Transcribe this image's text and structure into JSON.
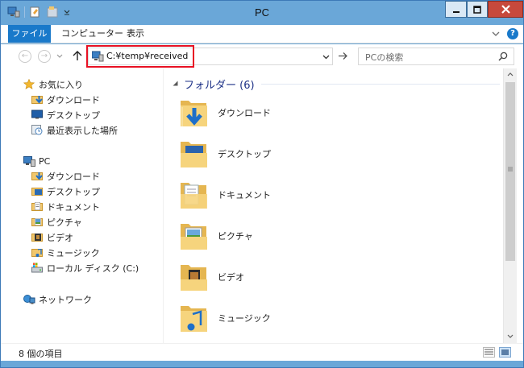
{
  "window": {
    "title": "PC"
  },
  "ribbon": {
    "tabs": [
      {
        "label": "ファイル"
      },
      {
        "label": "コンピューター"
      },
      {
        "label": "表示"
      }
    ]
  },
  "address": {
    "path": "C:¥temp¥received",
    "search_placeholder": "PCの検索"
  },
  "nav": {
    "favorites": {
      "label": "お気に入り",
      "items": [
        {
          "label": "ダウンロード",
          "icon": "download-folder-icon"
        },
        {
          "label": "デスクトップ",
          "icon": "desktop-icon"
        },
        {
          "label": "最近表示した場所",
          "icon": "recent-places-icon"
        }
      ]
    },
    "pc": {
      "label": "PC",
      "items": [
        {
          "label": "ダウンロード",
          "icon": "download-folder-icon"
        },
        {
          "label": "デスクトップ",
          "icon": "desktop-folder-icon"
        },
        {
          "label": "ドキュメント",
          "icon": "documents-folder-icon"
        },
        {
          "label": "ピクチャ",
          "icon": "pictures-folder-icon"
        },
        {
          "label": "ビデオ",
          "icon": "videos-folder-icon"
        },
        {
          "label": "ミュージック",
          "icon": "music-folder-icon"
        },
        {
          "label": "ローカル ディスク (C:)",
          "icon": "local-disk-icon"
        }
      ]
    },
    "network": {
      "label": "ネットワーク"
    }
  },
  "files": {
    "group_label": "フォルダー (6)",
    "folders": [
      {
        "label": "ダウンロード",
        "icon": "download-folder-icon"
      },
      {
        "label": "デスクトップ",
        "icon": "desktop-folder-icon"
      },
      {
        "label": "ドキュメント",
        "icon": "documents-folder-icon"
      },
      {
        "label": "ピクチャ",
        "icon": "pictures-folder-icon"
      },
      {
        "label": "ビデオ",
        "icon": "videos-folder-icon"
      },
      {
        "label": "ミュージック",
        "icon": "music-folder-icon"
      }
    ]
  },
  "status": {
    "item_count": "8 個の項目"
  },
  "colors": {
    "accent": "#1979ca",
    "titlebar": "#6aa7d8",
    "close": "#c7493c",
    "highlight": "#e81123",
    "group_header": "#1e3287"
  }
}
